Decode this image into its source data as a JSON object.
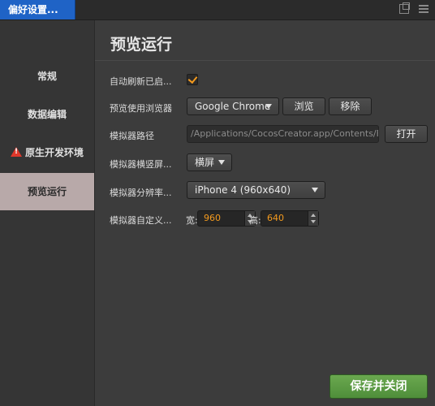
{
  "window": {
    "tab_title": "偏好设置..."
  },
  "sidebar": {
    "items": [
      {
        "label": "常规"
      },
      {
        "label": "数据编辑"
      },
      {
        "label": "原生开发环境"
      },
      {
        "label": "预览运行"
      }
    ],
    "active_index": 3
  },
  "main": {
    "title": "预览运行",
    "auto_refresh": {
      "label": "自动刷新已启...",
      "checked": true
    },
    "browser": {
      "label": "预览使用浏览器",
      "selected": "Google Chrome",
      "browse_label": "浏览",
      "remove_label": "移除"
    },
    "simulator_path": {
      "label": "模拟器路径",
      "value": "/Applications/CocosCreator.app/Contents/F",
      "open_label": "打开"
    },
    "orientation": {
      "label": "模拟器横竖屏...",
      "selected": "横屏"
    },
    "resolution": {
      "label": "模拟器分辨率...",
      "selected": "iPhone 4 (960x640)"
    },
    "custom": {
      "label": "模拟器自定义...",
      "width_label": "宽:",
      "width_value": "960",
      "height_label": "高:",
      "height_value": "640"
    },
    "save_label": "保存并关闭"
  },
  "colors": {
    "accent": "#f39a1e",
    "tab_blue": "#1f63c6",
    "save_green": "#5c9c45"
  }
}
